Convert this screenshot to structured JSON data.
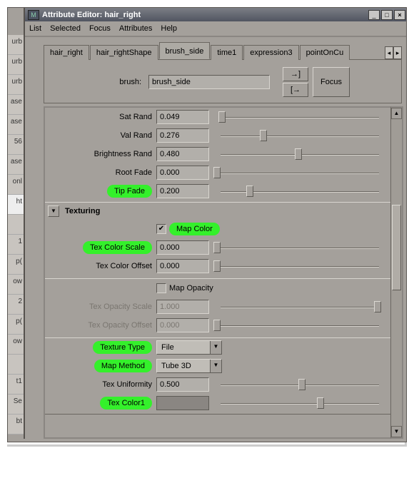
{
  "window": {
    "title": "Attribute Editor: hair_right"
  },
  "menu": [
    "List",
    "Selected",
    "Focus",
    "Attributes",
    "Help"
  ],
  "tabs": [
    "hair_right",
    "hair_rightShape",
    "brush_side",
    "time1",
    "expression3",
    "pointOnCu"
  ],
  "brush": {
    "label": "brush:",
    "value": "brush_side",
    "focus": "Focus"
  },
  "sliders": {
    "satRand": {
      "label": "Sat Rand",
      "value": "0.049",
      "pos": 0.05
    },
    "valRand": {
      "label": "Val Rand",
      "value": "0.276",
      "pos": 0.28
    },
    "brightRand": {
      "label": "Brightness Rand",
      "value": "0.480",
      "pos": 0.48
    },
    "rootFade": {
      "label": "Root Fade",
      "value": "0.000",
      "pos": 0.0
    },
    "tipFade": {
      "label": "Tip Fade",
      "value": "0.200",
      "pos": 0.2
    }
  },
  "texturing": {
    "sectionLabel": "Texturing",
    "mapColor": {
      "label": "Map Color",
      "checked": true
    },
    "texColorScale": {
      "label": "Tex Color Scale",
      "value": "0.000",
      "pos": 0.0
    },
    "texColorOffset": {
      "label": "Tex Color Offset",
      "value": "0.000",
      "pos": 0.0
    },
    "mapOpacity": {
      "label": "Map Opacity",
      "checked": false
    },
    "texOpacityScale": {
      "label": "Tex Opacity Scale",
      "value": "1.000",
      "pos": 1.0
    },
    "texOpacityOffset": {
      "label": "Tex Opacity Offset",
      "value": "0.000",
      "pos": 0.0
    },
    "textureType": {
      "label": "Texture Type",
      "value": "File"
    },
    "mapMethod": {
      "label": "Map Method",
      "value": "Tube 3D"
    },
    "texUniformity": {
      "label": "Tex Uniformity",
      "value": "0.500",
      "pos": 0.5
    },
    "texColor1": {
      "label": "Tex Color1"
    }
  },
  "left_strip": [
    "urb",
    "urb",
    "urb",
    "ase",
    "ase",
    "56",
    "ase",
    "onl",
    "ht",
    "",
    "1",
    "pt",
    "ow",
    "2",
    "pt",
    "ow",
    "",
    "t1",
    "Se",
    "bt"
  ]
}
